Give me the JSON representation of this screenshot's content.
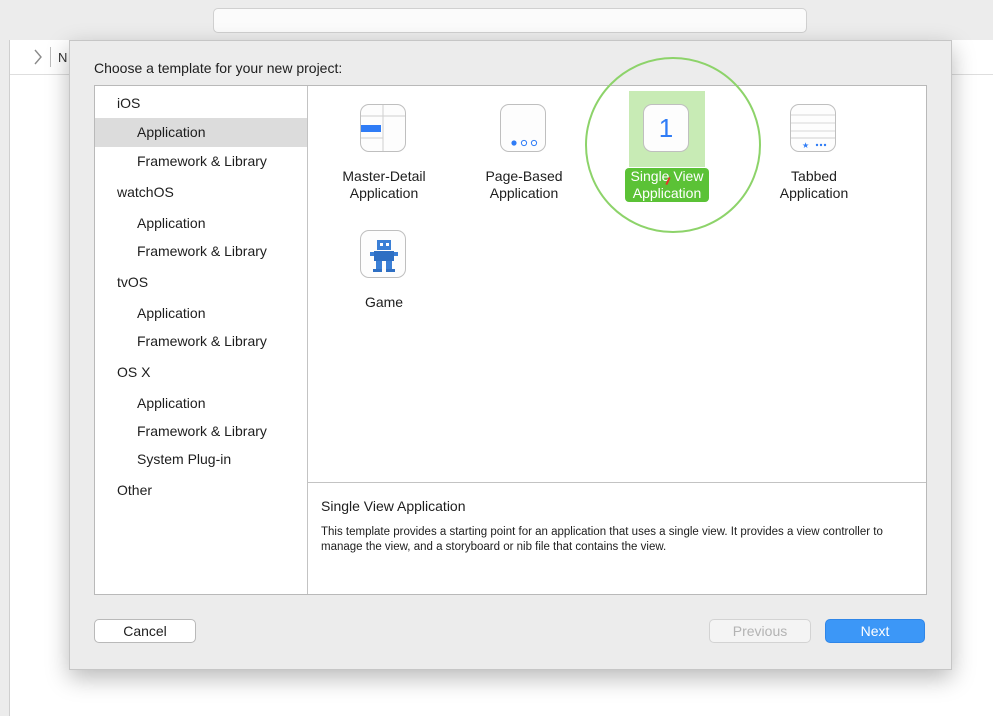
{
  "background": {
    "breadcrumb_fragment": "N"
  },
  "dialog": {
    "title": "Choose a template for your new project:",
    "sidebar": [
      {
        "label": "iOS",
        "kind": "platform",
        "selected": false
      },
      {
        "label": "Application",
        "kind": "category",
        "selected": true
      },
      {
        "label": "Framework & Library",
        "kind": "category",
        "selected": false
      },
      {
        "label": "watchOS",
        "kind": "platform",
        "selected": false
      },
      {
        "label": "Application",
        "kind": "category",
        "selected": false
      },
      {
        "label": "Framework & Library",
        "kind": "category",
        "selected": false
      },
      {
        "label": "tvOS",
        "kind": "platform",
        "selected": false
      },
      {
        "label": "Application",
        "kind": "category",
        "selected": false
      },
      {
        "label": "Framework & Library",
        "kind": "category",
        "selected": false
      },
      {
        "label": "OS X",
        "kind": "platform",
        "selected": false
      },
      {
        "label": "Application",
        "kind": "category",
        "selected": false
      },
      {
        "label": "Framework & Library",
        "kind": "category",
        "selected": false
      },
      {
        "label": "System Plug-in",
        "kind": "category",
        "selected": false
      },
      {
        "label": "Other",
        "kind": "platform",
        "selected": false
      }
    ],
    "templates": [
      {
        "line1": "Master-Detail",
        "line2": "Application",
        "icon": "master-detail-icon",
        "selected": false
      },
      {
        "line1": "Page-Based",
        "line2": "Application",
        "icon": "page-based-icon",
        "selected": false
      },
      {
        "line1": "Single View",
        "line2": "Application",
        "icon": "single-view-icon",
        "icon_text": "1",
        "selected": true
      },
      {
        "line1": "Tabbed",
        "line2": "Application",
        "icon": "tabbed-icon",
        "selected": false
      },
      {
        "line1": "Game",
        "line2": "",
        "icon": "game-icon",
        "selected": false
      }
    ],
    "description": {
      "title": "Single View Application",
      "text": "This template provides a starting point for an application that uses a single view. It provides a view controller to manage the view, and a storyboard or nib file that contains the view."
    },
    "buttons": {
      "cancel": "Cancel",
      "previous": "Previous",
      "next": "Next"
    }
  },
  "colors": {
    "selection_green": "#5bc236",
    "next_blue": "#3c97f7",
    "annotation_ring": "#8dd36a",
    "icon_blue": "#2f7cf6"
  }
}
